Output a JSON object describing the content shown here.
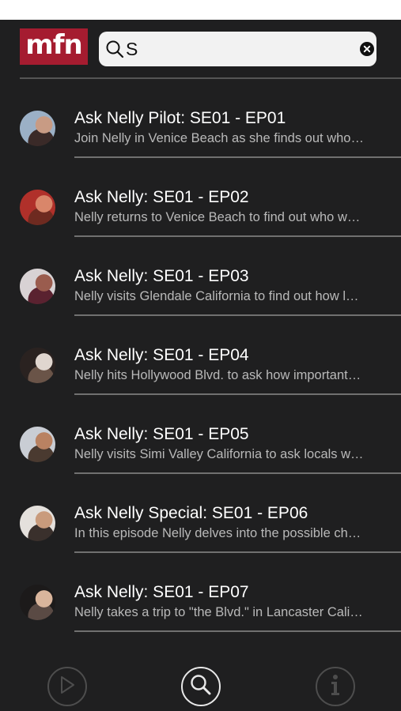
{
  "header": {
    "logo_text": "mfn",
    "search": {
      "value": "S",
      "placeholder": ""
    }
  },
  "results": [
    {
      "title": "Ask Nelly Pilot: SE01 - EP01",
      "description": "Join Nelly in Venice Beach as she finds out who…",
      "thumb_colors": [
        "#9bb0c6",
        "#c89b84",
        "#3a2a28"
      ]
    },
    {
      "title": "Ask Nelly: SE01 - EP02",
      "description": "Nelly returns to Venice Beach to find out who w…",
      "thumb_colors": [
        "#b0302a",
        "#d9866a",
        "#6e2a20"
      ]
    },
    {
      "title": "Ask Nelly: SE01 - EP03",
      "description": "Nelly visits Glendale California to find out how l…",
      "thumb_colors": [
        "#d8d2d4",
        "#9a5c4e",
        "#5a2230"
      ]
    },
    {
      "title": "Ask Nelly: SE01 - EP04",
      "description": "Nelly hits Hollywood Blvd. to ask how important…",
      "thumb_colors": [
        "#2a2220",
        "#e0d6cf",
        "#6a5448"
      ]
    },
    {
      "title": "Ask Nelly: SE01 - EP05",
      "description": "Nelly visits Simi Valley California to ask locals w…",
      "thumb_colors": [
        "#c9cdd4",
        "#b98262",
        "#4a3a30"
      ]
    },
    {
      "title": "Ask Nelly Special: SE01 - EP06",
      "description": "In this episode Nelly delves into the possible ch…",
      "thumb_colors": [
        "#e4e0dc",
        "#c99b7c",
        "#3a302c"
      ]
    },
    {
      "title": "Ask Nelly: SE01 - EP07",
      "description": "Nelly takes a trip to \"the Blvd.\" in Lancaster Cali…",
      "thumb_colors": [
        "#1c1a1a",
        "#d9b59c",
        "#5a4a44"
      ]
    }
  ],
  "tabbar": {
    "items": [
      {
        "icon": "play-icon",
        "active": false
      },
      {
        "icon": "search-icon",
        "active": true
      },
      {
        "icon": "info-icon",
        "active": false
      }
    ]
  },
  "colors": {
    "background": "#1f1f20",
    "logo_red": "#a51c30",
    "title_text": "#ffffff",
    "description_text": "#b9b9b9",
    "divider": "#707070"
  }
}
